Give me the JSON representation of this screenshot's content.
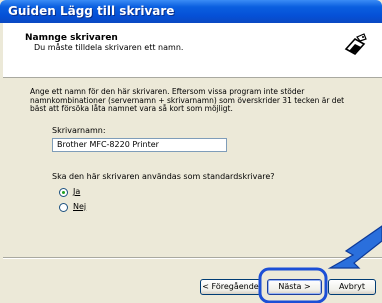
{
  "window": {
    "title": "Guiden Lägg till skrivare"
  },
  "header": {
    "title": "Namnge skrivaren",
    "subtitle": "Du måste tilldela skrivaren ett namn."
  },
  "content": {
    "intro": "Ange ett namn för den här skrivaren. Eftersom vissa program inte stöder namnkombinationer (servernamn + skrivarnamn) som överskrider 31 tecken är det bäst att försöka låta namnet vara så kort som möjligt.",
    "printer_name_label": "Skrivarnamn:",
    "printer_name_value": "Brother MFC-8220 Printer",
    "default_question": "Ska den här skrivaren användas som standardskrivare?",
    "options": [
      {
        "label": "Ja",
        "selected": true
      },
      {
        "label": "Nej",
        "selected": false
      }
    ]
  },
  "buttons": {
    "back": "< Föregående",
    "next": "Nästa >",
    "cancel": "Avbryt"
  },
  "colors": {
    "highlight": "#1c4fd6",
    "arrow": "#2a6fdc"
  }
}
